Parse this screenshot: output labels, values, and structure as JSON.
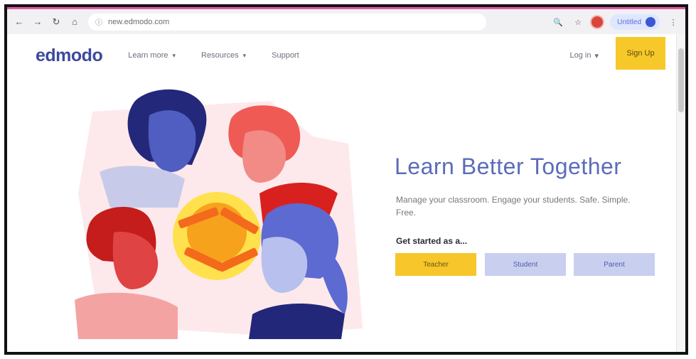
{
  "browser": {
    "url": "new.edmodo.com",
    "profile_label": "Untitled"
  },
  "nav": {
    "logo": "edmodo",
    "items": [
      {
        "label": "Learn more",
        "has_dropdown": true
      },
      {
        "label": "Resources",
        "has_dropdown": true
      },
      {
        "label": "Support",
        "has_dropdown": false
      }
    ],
    "login": "Log in",
    "signup": "Sign Up"
  },
  "hero": {
    "title": "Learn Better Together",
    "subtitle": "Manage your classroom. Engage your students. Safe. Simple. Free.",
    "get_started": "Get started as a...",
    "buttons": {
      "teacher": "Teacher",
      "student": "Student",
      "parent": "Parent"
    }
  },
  "colors": {
    "brand": "#3c4a9c",
    "accent": "#f7c829",
    "secondary_button": "#c9cfee",
    "title": "#5b6cba"
  },
  "icons": {
    "back": "back-arrow-icon",
    "forward": "forward-arrow-icon",
    "reload": "reload-icon",
    "home": "home-icon",
    "site_info": "site-info-icon"
  }
}
